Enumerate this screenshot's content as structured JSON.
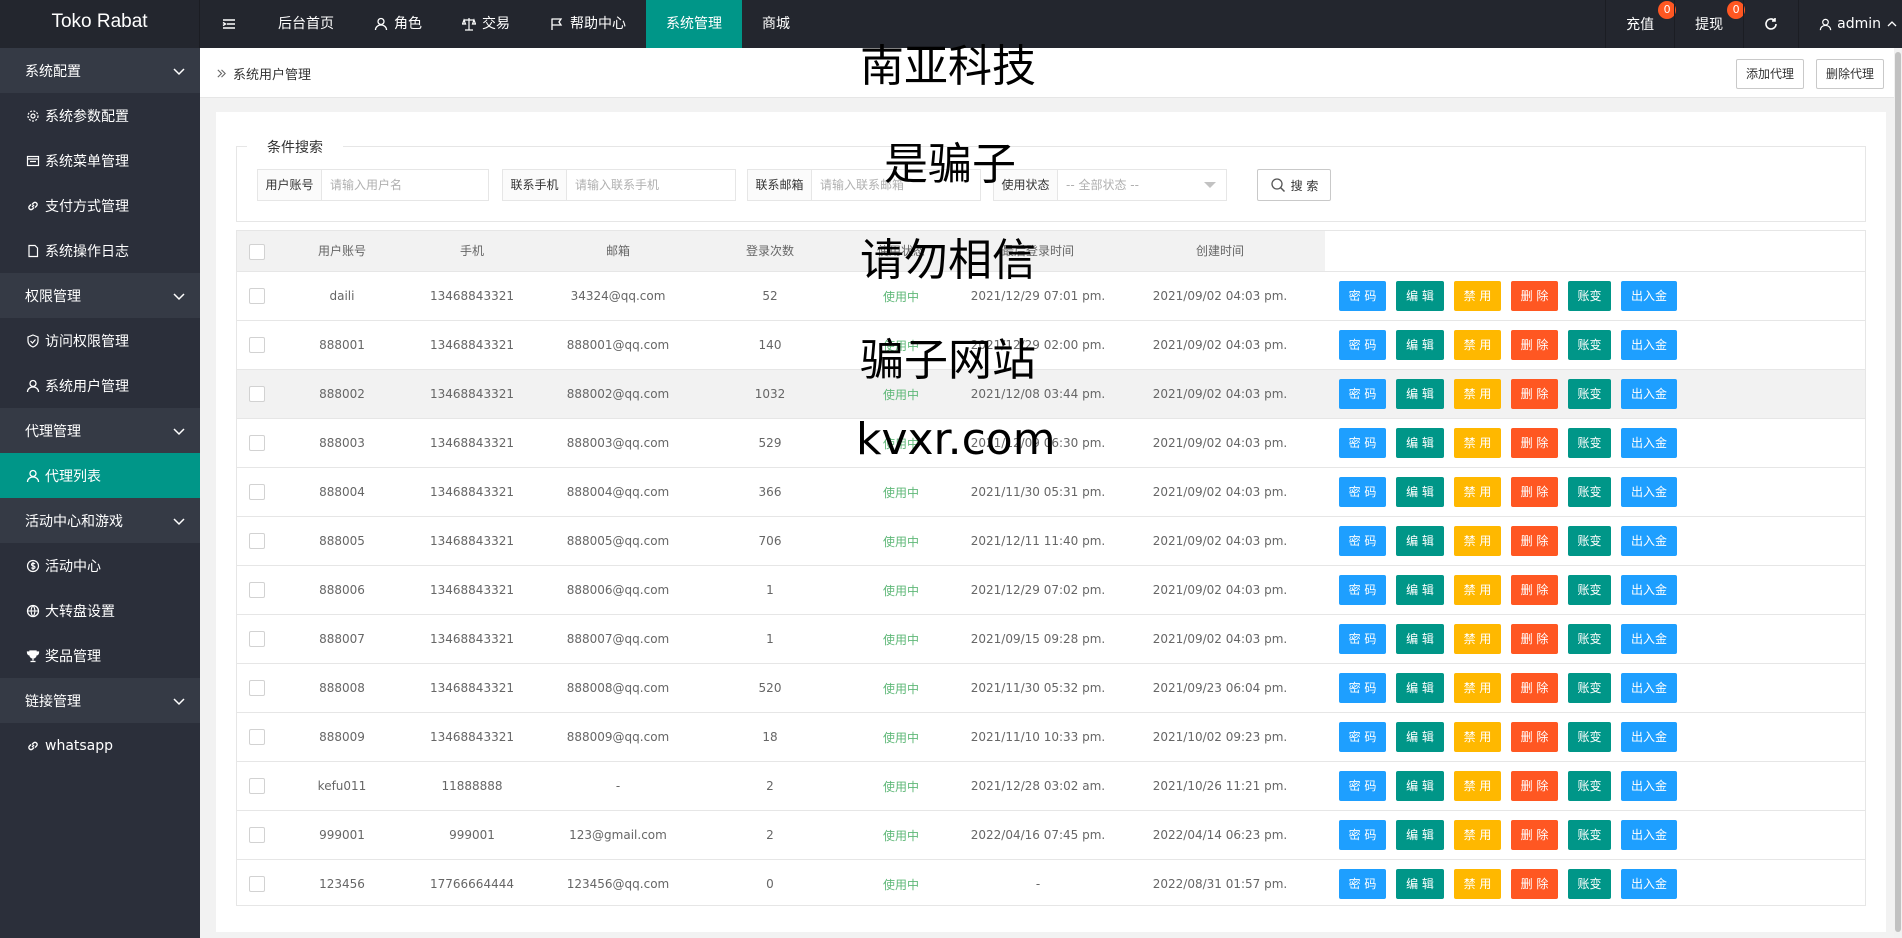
{
  "app": {
    "title": "Toko Rabat"
  },
  "topnav": {
    "items": [
      {
        "label": "后台首页"
      },
      {
        "label": "角色"
      },
      {
        "label": "交易"
      },
      {
        "label": "帮助中心"
      },
      {
        "label": "系统管理"
      },
      {
        "label": "商城"
      }
    ],
    "recharge": {
      "label": "充值",
      "count": "0"
    },
    "withdraw": {
      "label": "提现",
      "count": "0"
    },
    "user": "admin"
  },
  "sidebar": {
    "groups": [
      {
        "label": "系统配置",
        "items": [
          "系统参数配置",
          "系统菜单管理",
          "支付方式管理",
          "系统操作日志"
        ]
      },
      {
        "label": "权限管理",
        "items": [
          "访问权限管理",
          "系统用户管理"
        ]
      },
      {
        "label": "代理管理",
        "items": [
          "代理列表"
        ]
      },
      {
        "label": "活动中心和游戏",
        "items": [
          "活动中心",
          "大转盘设置",
          "奖品管理"
        ]
      },
      {
        "label": "链接管理",
        "items": [
          "whatsapp"
        ]
      }
    ]
  },
  "breadcrumb": {
    "current": "系统用户管理",
    "add_btn": "添加代理",
    "del_btn": "删除代理"
  },
  "search": {
    "legend": "条件搜索",
    "username_label": "用户账号",
    "username_placeholder": "请输入用户名",
    "phone_label": "联系手机",
    "phone_placeholder": "请输入联系手机",
    "email_label": "联系邮箱",
    "email_placeholder": "请输入联系邮箱",
    "status_label": "使用状态",
    "status_value": "-- 全部状态 --",
    "search_btn": "搜 索"
  },
  "table": {
    "headers": [
      "用户账号",
      "手机",
      "邮箱",
      "登录次数",
      "使用状态",
      "最后登录时间",
      "创建时间"
    ],
    "actions": [
      "密 码",
      "编 辑",
      "禁 用",
      "删 除",
      "账变",
      "出入金"
    ],
    "rows": [
      [
        "daili",
        "13468843321",
        "34324@qq.com",
        "52",
        "使用中",
        "2021/12/29 07:01 pm.",
        "2021/09/02 04:03 pm."
      ],
      [
        "888001",
        "13468843321",
        "888001@qq.com",
        "140",
        "使用中",
        "2021/12/29 02:00 pm.",
        "2021/09/02 04:03 pm."
      ],
      [
        "888002",
        "13468843321",
        "888002@qq.com",
        "1032",
        "使用中",
        "2021/12/08 03:44 pm.",
        "2021/09/02 04:03 pm."
      ],
      [
        "888003",
        "13468843321",
        "888003@qq.com",
        "529",
        "使用中",
        "2021/12/09 06:30 pm.",
        "2021/09/02 04:03 pm."
      ],
      [
        "888004",
        "13468843321",
        "888004@qq.com",
        "366",
        "使用中",
        "2021/11/30 05:31 pm.",
        "2021/09/02 04:03 pm."
      ],
      [
        "888005",
        "13468843321",
        "888005@qq.com",
        "706",
        "使用中",
        "2021/12/11 11:40 pm.",
        "2021/09/02 04:03 pm."
      ],
      [
        "888006",
        "13468843321",
        "888006@qq.com",
        "1",
        "使用中",
        "2021/12/29 07:02 pm.",
        "2021/09/02 04:03 pm."
      ],
      [
        "888007",
        "13468843321",
        "888007@qq.com",
        "1",
        "使用中",
        "2021/09/15 09:28 pm.",
        "2021/09/02 04:03 pm."
      ],
      [
        "888008",
        "13468843321",
        "888008@qq.com",
        "520",
        "使用中",
        "2021/11/30 05:32 pm.",
        "2021/09/23 06:04 pm."
      ],
      [
        "888009",
        "13468843321",
        "888009@qq.com",
        "18",
        "使用中",
        "2021/11/10 10:33 pm.",
        "2021/10/02 09:23 pm."
      ],
      [
        "kefu011",
        "11888888",
        "-",
        "2",
        "使用中",
        "2021/12/28 03:02 am.",
        "2021/10/26 11:21 pm."
      ],
      [
        "999001",
        "999001",
        "123@gmail.com",
        "2",
        "使用中",
        "2022/04/16 07:45 pm.",
        "2022/04/14 06:23 pm."
      ],
      [
        "123456",
        "17766664444",
        "123456@qq.com",
        "0",
        "使用中",
        "-",
        "2022/08/31 01:57 pm."
      ]
    ]
  },
  "watermarks": [
    "南亚科技",
    "是骗子",
    "请勿相信",
    "骗子网站",
    "kvxr.com"
  ]
}
